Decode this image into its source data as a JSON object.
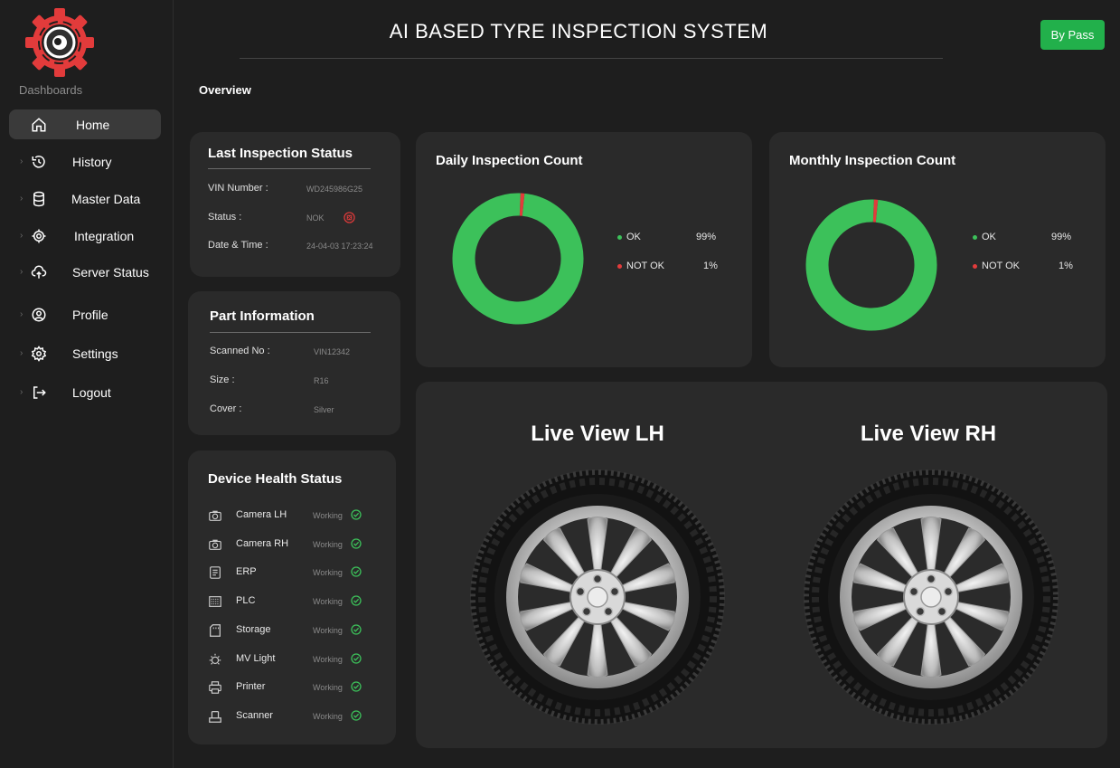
{
  "sidebar": {
    "dashboards_label": "Dashboards",
    "items": [
      {
        "label": "Home",
        "icon": "home-icon",
        "active": true
      },
      {
        "label": "History",
        "icon": "history-icon"
      },
      {
        "label": "Master Data",
        "icon": "database-icon"
      },
      {
        "label": "Integration",
        "icon": "integration-icon"
      },
      {
        "label": "Server Status",
        "icon": "cloud-server-icon"
      },
      {
        "label": "Profile",
        "icon": "user-icon"
      },
      {
        "label": "Settings",
        "icon": "gear-icon"
      },
      {
        "label": "Logout",
        "icon": "logout-icon"
      }
    ]
  },
  "header": {
    "title": "AI BASED TYRE INSPECTION SYSTEM",
    "bypass_label": "By Pass"
  },
  "overview_label": "Overview",
  "last_inspection": {
    "title": "Last Inspection Status",
    "vin_label": "VIN Number :",
    "vin_value": "WD245986G25",
    "status_label": "Status :",
    "status_value": "NOK",
    "datetime_label": "Date & Time :",
    "datetime_value": "24-04-03 17:23:24"
  },
  "part_info": {
    "title": "Part Information",
    "scanned_label": "Scanned No :",
    "scanned_value": "VIN12342",
    "size_label": "Size :",
    "size_value": "R16",
    "cover_label": "Cover :",
    "cover_value": "Silver"
  },
  "device_health": {
    "title": "Device Health Status",
    "devices": [
      {
        "name": "Camera LH",
        "status": "Working",
        "icon": "camera-icon"
      },
      {
        "name": "Camera RH",
        "status": "Working",
        "icon": "camera-icon"
      },
      {
        "name": "ERP",
        "status": "Working",
        "icon": "erp-icon"
      },
      {
        "name": "PLC",
        "status": "Working",
        "icon": "plc-icon"
      },
      {
        "name": "Storage",
        "status": "Working",
        "icon": "storage-icon"
      },
      {
        "name": "MV Light",
        "status": "Working",
        "icon": "light-icon"
      },
      {
        "name": "Printer",
        "status": "Working",
        "icon": "printer-icon"
      },
      {
        "name": "Scanner",
        "status": "Working",
        "icon": "scanner-icon"
      }
    ]
  },
  "daily": {
    "title": "Daily Inspection Count",
    "ok_label": "OK",
    "ok_pct": "99%",
    "nok_label": "NOT OK",
    "nok_pct": "1%"
  },
  "monthly": {
    "title": "Monthly Inspection Count",
    "ok_label": "OK",
    "ok_pct": "99%",
    "nok_label": "NOT OK",
    "nok_pct": "1%"
  },
  "live": {
    "lh_title": "Live View LH",
    "rh_title": "Live View RH"
  },
  "colors": {
    "ok": "#3cc15a",
    "nok": "#e23b3b",
    "accent": "#22b04b",
    "card": "#2a2a2a",
    "background": "#1e1e1e"
  },
  "chart_data": [
    {
      "type": "pie",
      "categories": [
        "OK",
        "NOT OK"
      ],
      "values": [
        99,
        1
      ],
      "title": "Daily Inspection Count"
    },
    {
      "type": "pie",
      "categories": [
        "OK",
        "NOT OK"
      ],
      "values": [
        99,
        1
      ],
      "title": "Monthly Inspection Count"
    }
  ]
}
